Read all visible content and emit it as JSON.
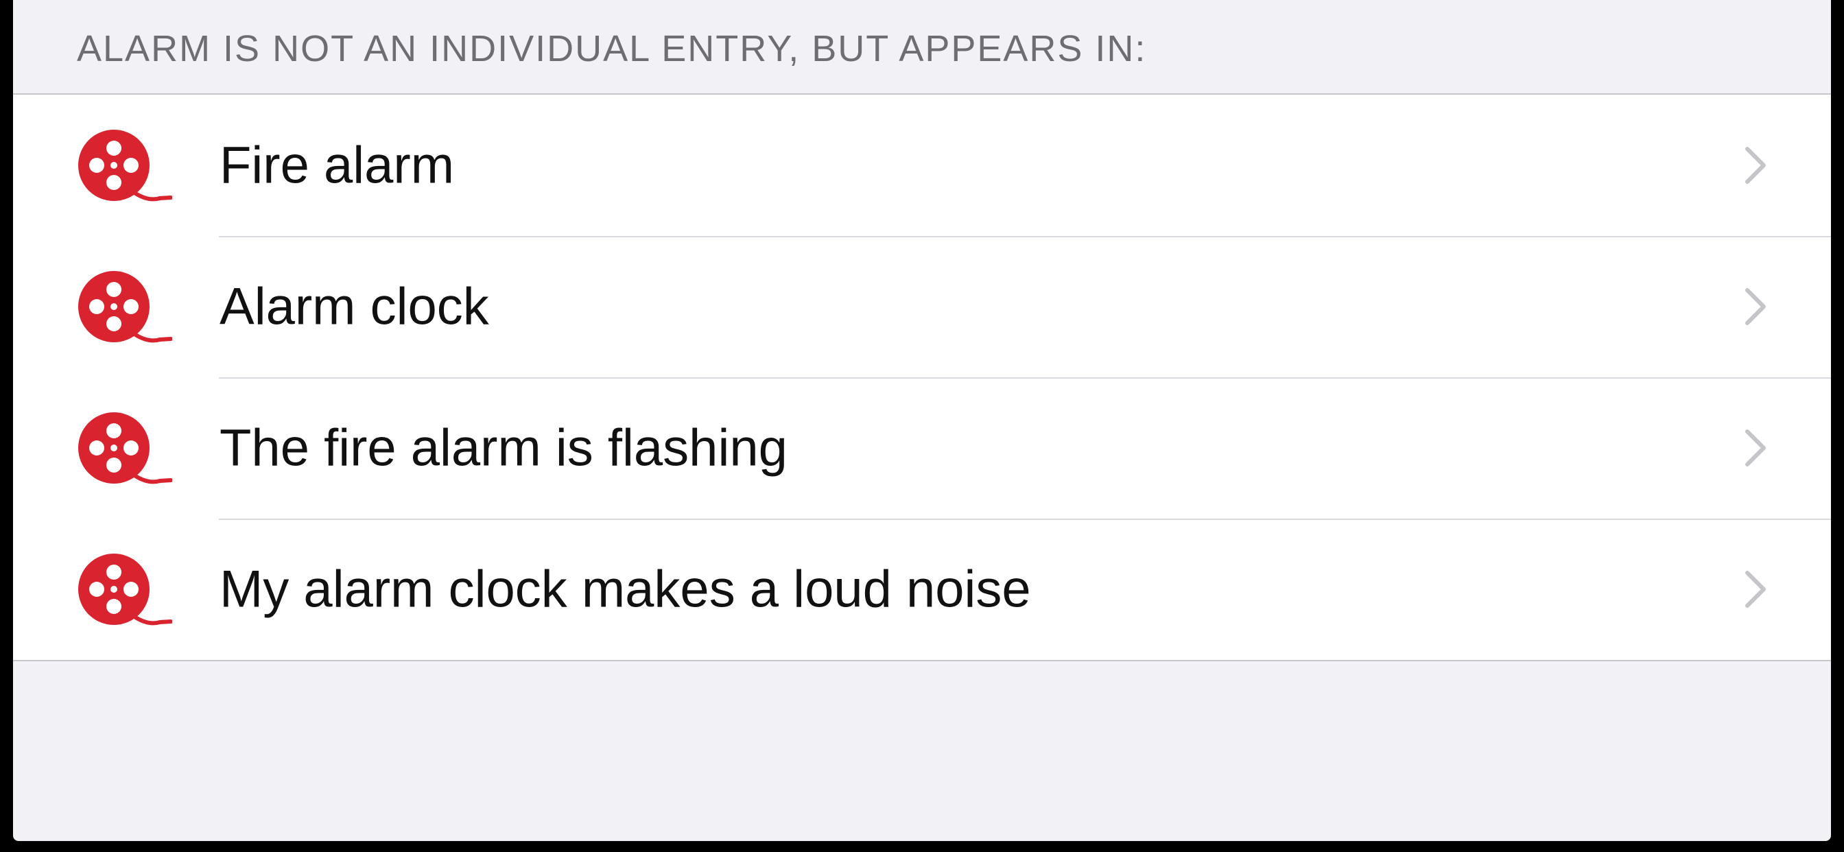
{
  "section": {
    "header": "ALARM IS NOT AN INDIVIDUAL ENTRY, BUT APPEARS IN:"
  },
  "items": [
    {
      "label": "Fire alarm",
      "icon": "film-reel-icon"
    },
    {
      "label": "Alarm clock",
      "icon": "film-reel-icon"
    },
    {
      "label": "The fire alarm is flashing",
      "icon": "film-reel-icon"
    },
    {
      "label": "My alarm clock makes a loud noise",
      "icon": "film-reel-icon"
    }
  ],
  "colors": {
    "icon": "#d9232e",
    "background": "#f2f1f6",
    "chevron": "#c4c4c9"
  }
}
